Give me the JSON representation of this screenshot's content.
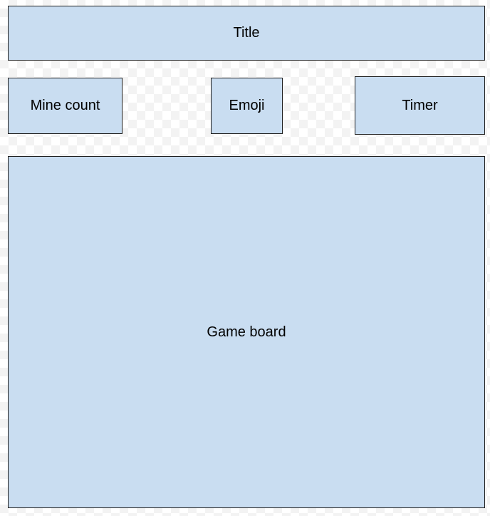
{
  "wireframe": {
    "title_label": "Title",
    "mine_count_label": "Mine count",
    "emoji_label": "Emoji",
    "timer_label": "Timer",
    "game_board_label": "Game board"
  },
  "colors": {
    "box_fill": "#c9ddf1",
    "box_border": "#1f1f1f"
  }
}
